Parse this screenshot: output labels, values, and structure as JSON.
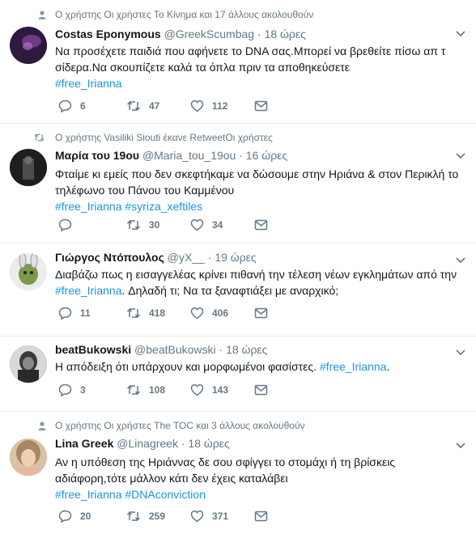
{
  "tweets": [
    {
      "context": "Ο χρήστης Οι χρήστες Το Κίνημα και 17 άλλους ακολουθούν",
      "context_icon": "person-icon",
      "fullname": "Costas Eponymous",
      "handle": "@GreekScumbag",
      "dot": "·",
      "time": "18 ώρες",
      "lines": [
        "Να προσέχετε παιδιά που αφήνετε το DNA σας.Μπορεί να βρεθείτε πίσω απ τ",
        "σίδερα.Να σκουπίζετε καλά τα όπλα πριν τα αποθηκεύσετε"
      ],
      "tags": "#free_Irianna",
      "replies": "6",
      "retweets": "47",
      "likes": "112",
      "avatar_color": "#3a2148"
    },
    {
      "context": "Ο χρήστης Vasiliki Siouti έκανε RetweetΟι χρήστες",
      "context_icon": "retweet-icon",
      "fullname": "Μαρία του 19ου",
      "handle": "@Maria_tou_19ou",
      "dot": "·",
      "time": "16 ώρες",
      "lines": [
        "Φταίμε κι εμείς που δεν σκεφτήκαμε να δώσουμε στην Ηριάνα & στον Περικλή το",
        "τηλέφωνο του Πάνου του  Καμμένου"
      ],
      "tags": "#free_Irianna #syriza_xeftiles",
      "replies": "",
      "retweets": "30",
      "likes": "34",
      "avatar_color": "#2b2b2b"
    },
    {
      "fullname": "Γιώργος Ντόπουλος",
      "handle": "@yX__",
      "dot": "·",
      "time": "19 ώρες",
      "line1": "Διαβάζω πως η εισαγγελέας κρίνει πιθανή την τέλεση νέων εγκλημάτων από την",
      "tag_inline": "#free_Irianna",
      "line2_rest": ". Δηλαδή τι; Να τα ξαναφτιάξει με αναρχικό;",
      "replies": "11",
      "retweets": "418",
      "likes": "406",
      "avatar_color": "#4a7a3a"
    },
    {
      "fullname": "beatBukowski",
      "handle": "@beatBukowski",
      "dot": "·",
      "time": "18 ώρες",
      "line1_pre": "Η απόδειξη ότι υπάρχουν και μορφωμένοι φασίστες. ",
      "tag_inline": "#free_Irianna",
      "line1_post": ".",
      "replies": "3",
      "retweets": "108",
      "likes": "143",
      "avatar_color": "#5a5a5a"
    },
    {
      "context": "Ο χρήστης Οι χρήστες The TOC και 3 άλλους ακολουθούν",
      "context_icon": "person-icon",
      "fullname": "Lina Greek",
      "handle": "@Linagreek",
      "dot": "·",
      "time": "18 ώρες",
      "lines": [
        "Αν η υπόθεση της Ηριάννας δε σου σφίγγει το στομάχι ή τη βρίσκεις",
        "αδιάφορη,τότε μάλλον κάτι δεν έχεις καταλάβει"
      ],
      "tags": "#free_Irianna #DNAconviction",
      "replies": "20",
      "retweets": "259",
      "likes": "371",
      "avatar_color": "#c9a58a"
    }
  ],
  "colors": {
    "link": "#1b95e0",
    "meta": "#657786",
    "text": "#14171a",
    "divider": "#e6ecf0"
  }
}
